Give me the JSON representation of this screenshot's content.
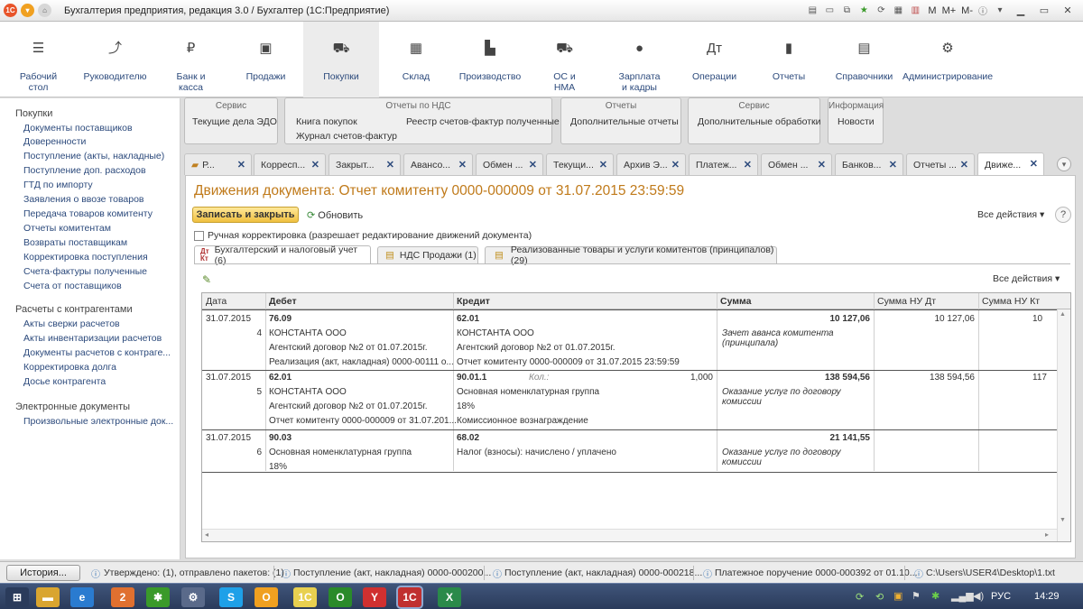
{
  "titlebar": {
    "title": "Бухгалтерия предприятия, редакция 3.0 / Бухгалтер (1С:Предприятие)",
    "m_labels": [
      "M",
      "M+",
      "M-"
    ]
  },
  "sections": [
    {
      "label": "Рабочий\nстол",
      "icon": "☰",
      "icon_name": "menu-icon"
    },
    {
      "label": "Руководителю",
      "icon": "⤴",
      "icon_name": "trend-icon"
    },
    {
      "label": "Банк и\nкасса",
      "icon": "₽",
      "icon_name": "ruble-icon"
    },
    {
      "label": "Продажи",
      "icon": "▣",
      "icon_name": "bag-icon"
    },
    {
      "label": "Покупки",
      "icon": "⛟",
      "icon_name": "cart-icon",
      "active": true
    },
    {
      "label": "Склад",
      "icon": "▦",
      "icon_name": "warehouse-icon"
    },
    {
      "label": "Производство",
      "icon": "▙",
      "icon_name": "factory-icon"
    },
    {
      "label": "ОС и\nНМА",
      "icon": "⛟",
      "icon_name": "truck-icon"
    },
    {
      "label": "Зарплата\nи кадры",
      "icon": "●",
      "icon_name": "person-icon"
    },
    {
      "label": "Операции",
      "icon": "Дт",
      "icon_name": "dt-kt-icon"
    },
    {
      "label": "Отчеты",
      "icon": "▮",
      "icon_name": "bar-chart-icon"
    },
    {
      "label": "Справочники",
      "icon": "▤",
      "icon_name": "book-icon"
    },
    {
      "label": "Администрирование",
      "icon": "⚙",
      "icon_name": "gear-icon"
    }
  ],
  "sidebar": {
    "groups": [
      {
        "title": "Покупки",
        "items": [
          "Документы поставщиков",
          "Доверенности",
          "Поступление (акты, накладные)",
          "Поступление доп. расходов",
          "ГТД по импорту",
          "Заявления о ввозе товаров",
          "Передача товаров комитенту",
          "Отчеты комитентам",
          "Возвраты поставщикам",
          "Корректировка поступления",
          "Счета-фактуры полученные",
          "Счета от поставщиков"
        ]
      },
      {
        "title": "Расчеты с контрагентами",
        "items": [
          "Акты сверки расчетов",
          "Акты инвентаризации расчетов",
          "Документы расчетов с контраге...",
          "Корректировка долга",
          "Досье контрагента"
        ]
      },
      {
        "title": "Электронные документы",
        "items": [
          "Произвольные электронные док..."
        ]
      }
    ]
  },
  "command_groups": [
    {
      "title": "Сервис",
      "items": [
        "Текущие дела ЭДО"
      ]
    },
    {
      "title": "Отчеты по НДС",
      "items": [
        "Книга покупок",
        "Журнал счетов-фактур",
        "Реестр счетов-фактур полученные"
      ]
    },
    {
      "title": "Отчеты",
      "items": [
        "Дополнительные отчеты"
      ]
    },
    {
      "title": "Сервис",
      "items": [
        "Дополнительные обработки"
      ]
    },
    {
      "title": "Информация",
      "items": [
        "Новости"
      ]
    }
  ],
  "open_tabs": [
    "Р...",
    "Корресп...",
    "Закрыт...",
    "Авансо...",
    "Обмен ...",
    "Текущи...",
    "Архив Э...",
    "Платеж...",
    "Обмен ...",
    "Банков...",
    "Отчеты ...",
    "Движе..."
  ],
  "form": {
    "title": "Движения документа: Отчет комитенту 0000-000009 от 31.07.2015 23:59:59",
    "save_close": "Записать и закрыть",
    "refresh": "Обновить",
    "all_actions": "Все действия ▾",
    "help": "?",
    "manual_checkbox": "Ручная корректировка (разрешает редактирование движений документа)",
    "inner_tabs": [
      {
        "label": "Бухгалтерский и налоговый учет (6)",
        "icon": "Дт"
      },
      {
        "label": "НДС Продажи (1)",
        "icon": "▤"
      },
      {
        "label": "Реализованные товары и услуги комитентов (принципалов) (29)",
        "icon": "▤"
      }
    ],
    "table_all_actions": "Все действия ▾"
  },
  "table": {
    "columns": [
      "Дата",
      "Дебет",
      "Кредит",
      "Сумма",
      "Сумма НУ Дт",
      "Сумма НУ Кт"
    ],
    "rows": [
      {
        "date": "31.07.2015",
        "num": "4",
        "debit": [
          "76.09",
          "КОНСТАНТА ООО",
          "Агентский договор №2 от 01.07.2015г.",
          "Реализация (акт, накладная) 0000-00111 о..."
        ],
        "credit": [
          "62.01",
          "КОНСТАНТА ООО",
          "Агентский договор №2 от 01.07.2015г.",
          "Отчет комитенту 0000-000009 от 31.07.2015 23:59:59"
        ],
        "qty_label": "",
        "qty": "",
        "sum": "10 127,06",
        "content": [
          "Зачет аванса комитента",
          "(принципала)"
        ],
        "nu_dt": "10 127,06",
        "nu_kt": "10"
      },
      {
        "date": "31.07.2015",
        "num": "5",
        "debit": [
          "62.01",
          "КОНСТАНТА ООО",
          "Агентский договор №2 от 01.07.2015г.",
          "Отчет комитенту 0000-000009 от 31.07.201..."
        ],
        "credit": [
          "90.01.1",
          "Основная номенклатурная группа",
          "18%",
          "Комиссионное вознаграждение"
        ],
        "qty_label": "Кол.:",
        "qty": "1,000",
        "sum": "138 594,56",
        "content": [
          "Оказание услуг по договору",
          "комиссии"
        ],
        "nu_dt": "138 594,56",
        "nu_kt": "117"
      },
      {
        "date": "31.07.2015",
        "num": "6",
        "debit": [
          "90.03",
          "Основная номенклатурная группа",
          "18%"
        ],
        "credit": [
          "68.02",
          "Налог (взносы): начислено / уплачено"
        ],
        "qty_label": "",
        "qty": "",
        "sum": "21 141,55",
        "content": [
          "Оказание услуг по договору",
          "комиссии"
        ],
        "nu_dt": "",
        "nu_kt": ""
      }
    ]
  },
  "statusbar": {
    "history": "История...",
    "items": [
      "Утверждено: (1), отправлено пакетов: (1)",
      "Поступление (акт, накладная) 0000-000200...",
      "Поступление (акт, накладная) 0000-000218...",
      "Платежное поручение 0000-000392 от 01.10...",
      "C:\\Users\\USER4\\Desktop\\1.txt"
    ]
  },
  "taskbar": {
    "lang": "РУС",
    "time": "14:29",
    "apps": [
      {
        "name": "start-button",
        "glyph": "⊞",
        "color": "#2a3b5b"
      },
      {
        "name": "explorer-app",
        "glyph": "▬",
        "color": "#d9a530"
      },
      {
        "name": "ie-app",
        "glyph": "e",
        "color": "#2a7bd0"
      },
      {
        "name": "chrome-app",
        "glyph": "2",
        "color": "#e07030"
      },
      {
        "name": "virus-app",
        "glyph": "✱",
        "color": "#3a9a2a"
      },
      {
        "name": "network-app",
        "glyph": "⚙",
        "color": "#5a6a8a"
      },
      {
        "name": "skype-app",
        "glyph": "S",
        "color": "#1ea0e8"
      },
      {
        "name": "folder-app",
        "glyph": "O",
        "color": "#f0a020"
      },
      {
        "name": "onec-app",
        "glyph": "1С",
        "color": "#e8d050"
      },
      {
        "name": "green-app",
        "glyph": "O",
        "color": "#2a8a2a"
      },
      {
        "name": "yandex-app",
        "glyph": "Y",
        "color": "#d03030"
      },
      {
        "name": "onec-active-app",
        "glyph": "1С",
        "color": "#c03030"
      },
      {
        "name": "excel-app",
        "glyph": "X",
        "color": "#2a8a4a"
      }
    ]
  }
}
